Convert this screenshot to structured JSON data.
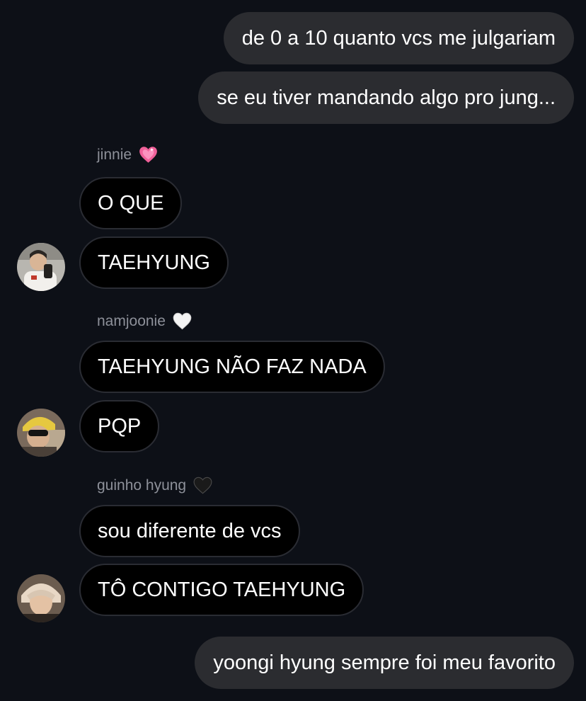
{
  "messages": {
    "out1": "de 0 a 10 quanto vcs me julgariam",
    "out2": "se eu tiver mandando algo pro jung...",
    "jinnie_1": "O QUE",
    "jinnie_2": "TAEHYUNG",
    "namjoonie_1": "TAEHYUNG NÃO FAZ NADA",
    "namjoonie_2": "PQP",
    "guinho_1": "sou diferente de vcs",
    "guinho_2": "TÔ CONTIGO TAEHYUNG",
    "out3": "yoongi hyung sempre foi meu favorito"
  },
  "senders": {
    "jinnie": {
      "name": "jinnie",
      "heart": "pink-heart-icon"
    },
    "namjoonie": {
      "name": "namjoonie",
      "heart": "white-heart-icon"
    },
    "guinho": {
      "name": "guinho hyung",
      "heart": "black-heart-icon"
    }
  },
  "colors": {
    "background": "#0d1017",
    "outgoing_bubble": "#2b2c30",
    "incoming_bubble": "#000000",
    "incoming_border": "#2a2c33",
    "sender_text": "#8d9099",
    "pink_heart": "#f0619a"
  }
}
